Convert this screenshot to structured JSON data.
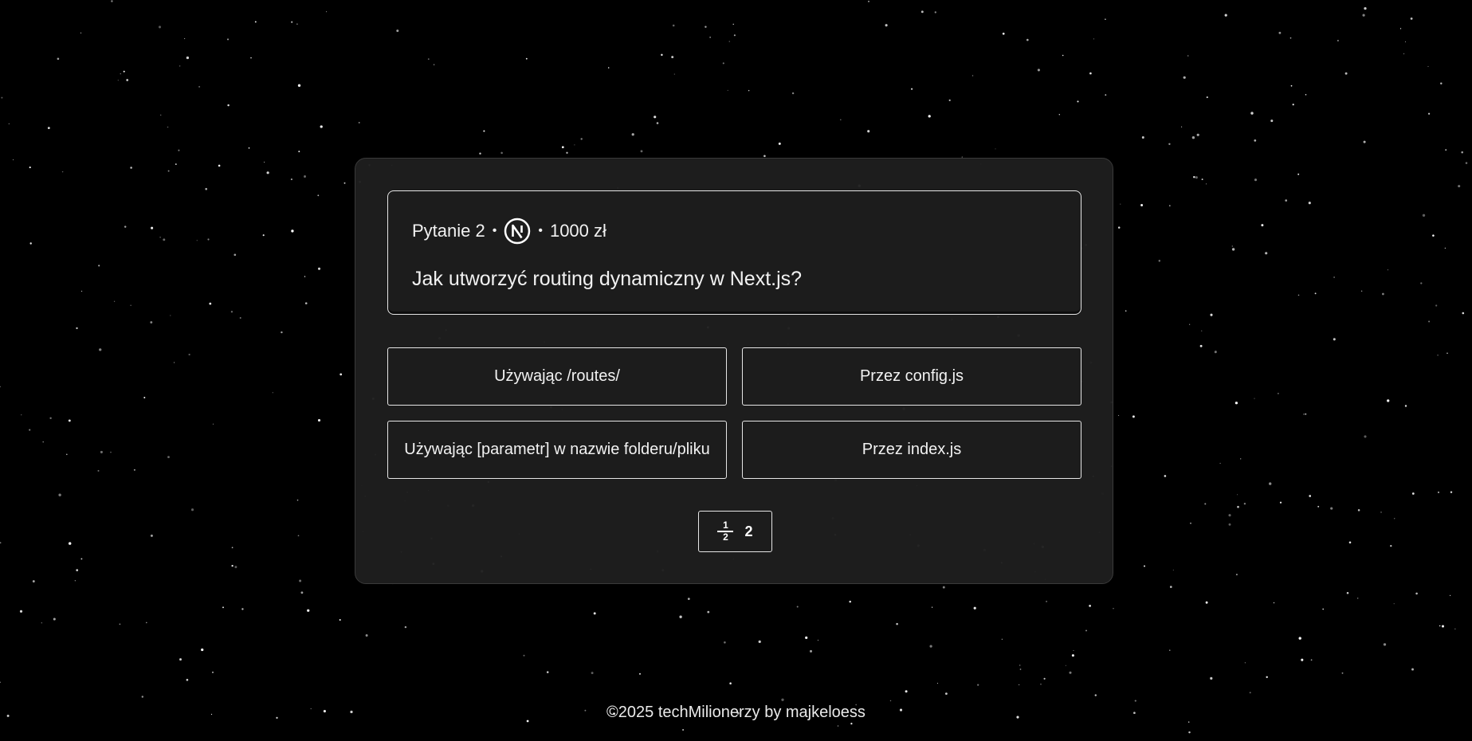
{
  "question": {
    "meta_label": "Pytanie 2",
    "separator": "•",
    "category_icon": "nextjs-logo-icon",
    "prize": "1000 zł",
    "text": "Jak utworzyć routing dynamiczny w Next.js?"
  },
  "answers": [
    {
      "label": "Używając /routes/"
    },
    {
      "label": "Przez config.js"
    },
    {
      "label": "Używając [parametr] w nazwie folderu/pliku"
    },
    {
      "label": "Przez index.js"
    }
  ],
  "lifeline": {
    "icon": "fifty-fifty-icon",
    "numerator": "1",
    "denominator": "2",
    "count": "2"
  },
  "footer": {
    "text": "©2025 techMilionerzy by majkeloess"
  },
  "colors": {
    "background": "#000000",
    "panel": "#1e1e1e",
    "border": "#e6e6e6",
    "text": "#f2f2f2"
  }
}
